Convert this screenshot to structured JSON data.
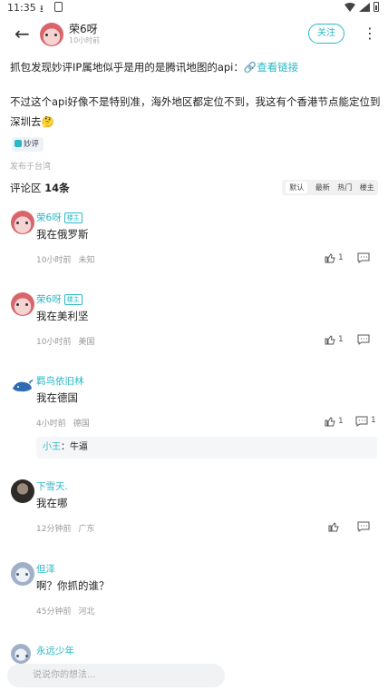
{
  "status_bar": {
    "time": "11:35"
  },
  "header": {
    "user_name": "荣6呀",
    "subtitle": "10小时前",
    "follow_label": "关注"
  },
  "post": {
    "text_1": "抓包发现妙评IP属地似乎是用的是腾讯地图的api：",
    "link_label": "查看链接",
    "text_2_line1": "不过这个api好像不是特别准，海外地区都定位不到，我这有个香港节点能定位到",
    "text_2_line2": "深圳去",
    "emoji": "🤔",
    "tag": "妙评",
    "origin": "发布于台湾"
  },
  "comments_section": {
    "title": "评论区",
    "count": "14条",
    "sort_options": [
      "默认",
      "最新",
      "热门",
      "楼主"
    ]
  },
  "comments": [
    {
      "name": "荣6呀",
      "badge": "楼主",
      "text": "我在俄罗斯",
      "time": "10小时前",
      "location": "未知",
      "likes": "1"
    },
    {
      "name": "荣6呀",
      "badge": "楼主",
      "text": "我在美利坚",
      "time": "10小时前",
      "location": "美国",
      "likes": "1"
    },
    {
      "name": "羁鸟依旧林",
      "text": "我在德国",
      "time": "4小时前",
      "location": "德国",
      "likes": "1",
      "replies": "1",
      "sub_reply": {
        "name": "小王",
        "text": "牛逼"
      }
    },
    {
      "name": "下雪天.",
      "text": "我在哪",
      "time": "12分钟前",
      "location": "广东"
    },
    {
      "name": "但泽",
      "text": "啊？你抓的谁？",
      "time": "45分钟前",
      "location": "河北"
    },
    {
      "name": "永远少年"
    }
  ],
  "input_bar": {
    "placeholder": "说说你的想法..."
  },
  "colors": {
    "accent": "#29b8c6"
  }
}
